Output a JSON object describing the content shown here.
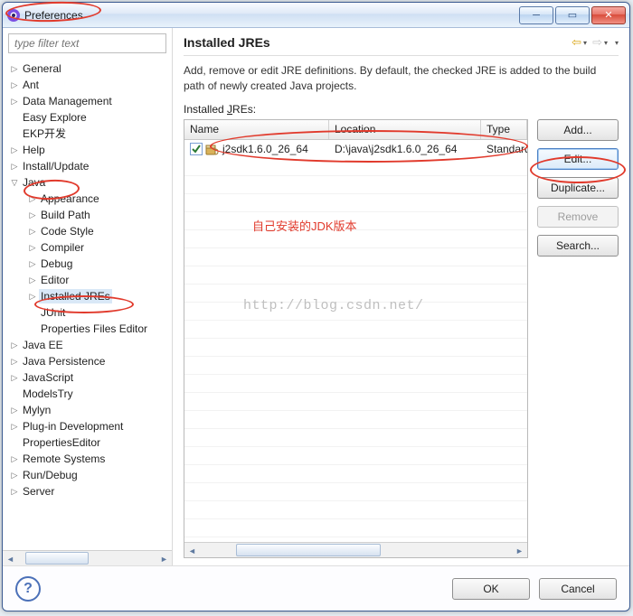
{
  "window": {
    "title": "Preferences"
  },
  "filter": {
    "placeholder": "type filter text"
  },
  "tree": [
    {
      "label": "General",
      "depth": 0,
      "twisty": "▷"
    },
    {
      "label": "Ant",
      "depth": 0,
      "twisty": "▷"
    },
    {
      "label": "Data Management",
      "depth": 0,
      "twisty": "▷"
    },
    {
      "label": "Easy Explore",
      "depth": 0,
      "twisty": ""
    },
    {
      "label": "EKP开发",
      "depth": 0,
      "twisty": ""
    },
    {
      "label": "Help",
      "depth": 0,
      "twisty": "▷"
    },
    {
      "label": "Install/Update",
      "depth": 0,
      "twisty": "▷"
    },
    {
      "label": "Java",
      "depth": 0,
      "twisty": "▽",
      "expanded": true
    },
    {
      "label": "Appearance",
      "depth": 1,
      "twisty": "▷"
    },
    {
      "label": "Build Path",
      "depth": 1,
      "twisty": "▷"
    },
    {
      "label": "Code Style",
      "depth": 1,
      "twisty": "▷"
    },
    {
      "label": "Compiler",
      "depth": 1,
      "twisty": "▷"
    },
    {
      "label": "Debug",
      "depth": 1,
      "twisty": "▷"
    },
    {
      "label": "Editor",
      "depth": 1,
      "twisty": "▷"
    },
    {
      "label": "Installed JREs",
      "depth": 1,
      "twisty": "▷",
      "selected": true
    },
    {
      "label": "JUnit",
      "depth": 1,
      "twisty": ""
    },
    {
      "label": "Properties Files Editor",
      "depth": 1,
      "twisty": ""
    },
    {
      "label": "Java EE",
      "depth": 0,
      "twisty": "▷"
    },
    {
      "label": "Java Persistence",
      "depth": 0,
      "twisty": "▷"
    },
    {
      "label": "JavaScript",
      "depth": 0,
      "twisty": "▷"
    },
    {
      "label": "ModelsTry",
      "depth": 0,
      "twisty": ""
    },
    {
      "label": "Mylyn",
      "depth": 0,
      "twisty": "▷"
    },
    {
      "label": "Plug-in Development",
      "depth": 0,
      "twisty": "▷"
    },
    {
      "label": "PropertiesEditor",
      "depth": 0,
      "twisty": ""
    },
    {
      "label": "Remote Systems",
      "depth": 0,
      "twisty": "▷"
    },
    {
      "label": "Run/Debug",
      "depth": 0,
      "twisty": "▷"
    },
    {
      "label": "Server",
      "depth": 0,
      "twisty": "▷"
    }
  ],
  "page": {
    "title": "Installed JREs",
    "description": "Add, remove or edit JRE definitions. By default, the checked JRE is added to the build path of newly created Java projects.",
    "list_label_pre": "Installed ",
    "list_label_u": "J",
    "list_label_post": "REs:"
  },
  "columns": {
    "c0": "Name",
    "c1": "Location",
    "c2": "Type"
  },
  "row": {
    "name": "j2sdk1.6.0_26_64",
    "location": "D:\\java\\j2sdk1.6.0_26_64",
    "type": "Standard"
  },
  "buttons": {
    "add": "Add...",
    "edit": "Edit...",
    "duplicate": "Duplicate...",
    "remove": "Remove",
    "search": "Search..."
  },
  "annotations": {
    "red_note": "自己安装的JDK版本",
    "watermark": "http://blog.csdn.net/"
  },
  "footer": {
    "ok": "OK",
    "cancel": "Cancel",
    "help": "?"
  }
}
